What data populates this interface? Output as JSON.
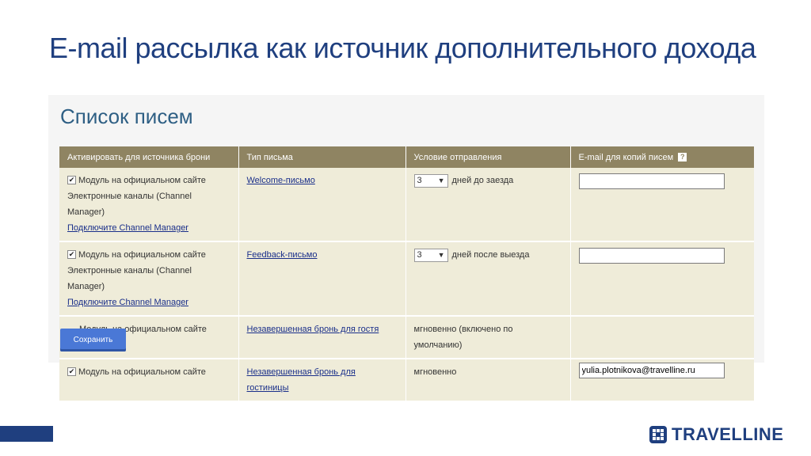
{
  "slide": {
    "title": "E-mail рассылка как источник дополнительного дохода"
  },
  "panel": {
    "title": "Список писем",
    "columns": [
      "Активировать для источника брони",
      "Тип письма",
      "Условие отправления",
      "E-mail для копий писем"
    ],
    "help_glyph": "?",
    "checkmark": "✔",
    "rows": [
      {
        "source_checked": true,
        "source_module": "Модуль на официальном сайте",
        "channel_text": "Электронные каналы (Channel Manager)",
        "connect_link": "Подключите Channel Manager",
        "letter_type": "Welcome-письмо",
        "days_value": "3",
        "condition": "дней  до заезда",
        "email": ""
      },
      {
        "source_checked": true,
        "source_module": "Модуль на официальном сайте",
        "channel_text": "Электронные каналы (Channel Manager)",
        "connect_link": "Подключите Channel Manager",
        "letter_type": "Feedback-письмо",
        "days_value": "3",
        "condition": "дней после выезда",
        "email": ""
      },
      {
        "source_checked": false,
        "source_module": "Модуль на официальном сайте",
        "letter_type": "Незавершенная бронь для гостя",
        "condition": "мгновенно (включено по умолчанию)"
      },
      {
        "source_checked": true,
        "source_module": "Модуль на официальном сайте",
        "letter_type": "Незавершенная бронь для гостиницы",
        "condition": "мгновенно",
        "email": "yulia.plotnikova@travelline.ru"
      }
    ],
    "save_label": "Сохранить"
  },
  "brand": {
    "name": "TRAVELLINE",
    "color": "#1f3f7f"
  },
  "colors": {
    "table_header": "#8f8462",
    "table_cell": "#efecd9",
    "save_button": "#4a78d6",
    "link": "#1a2f8a"
  }
}
